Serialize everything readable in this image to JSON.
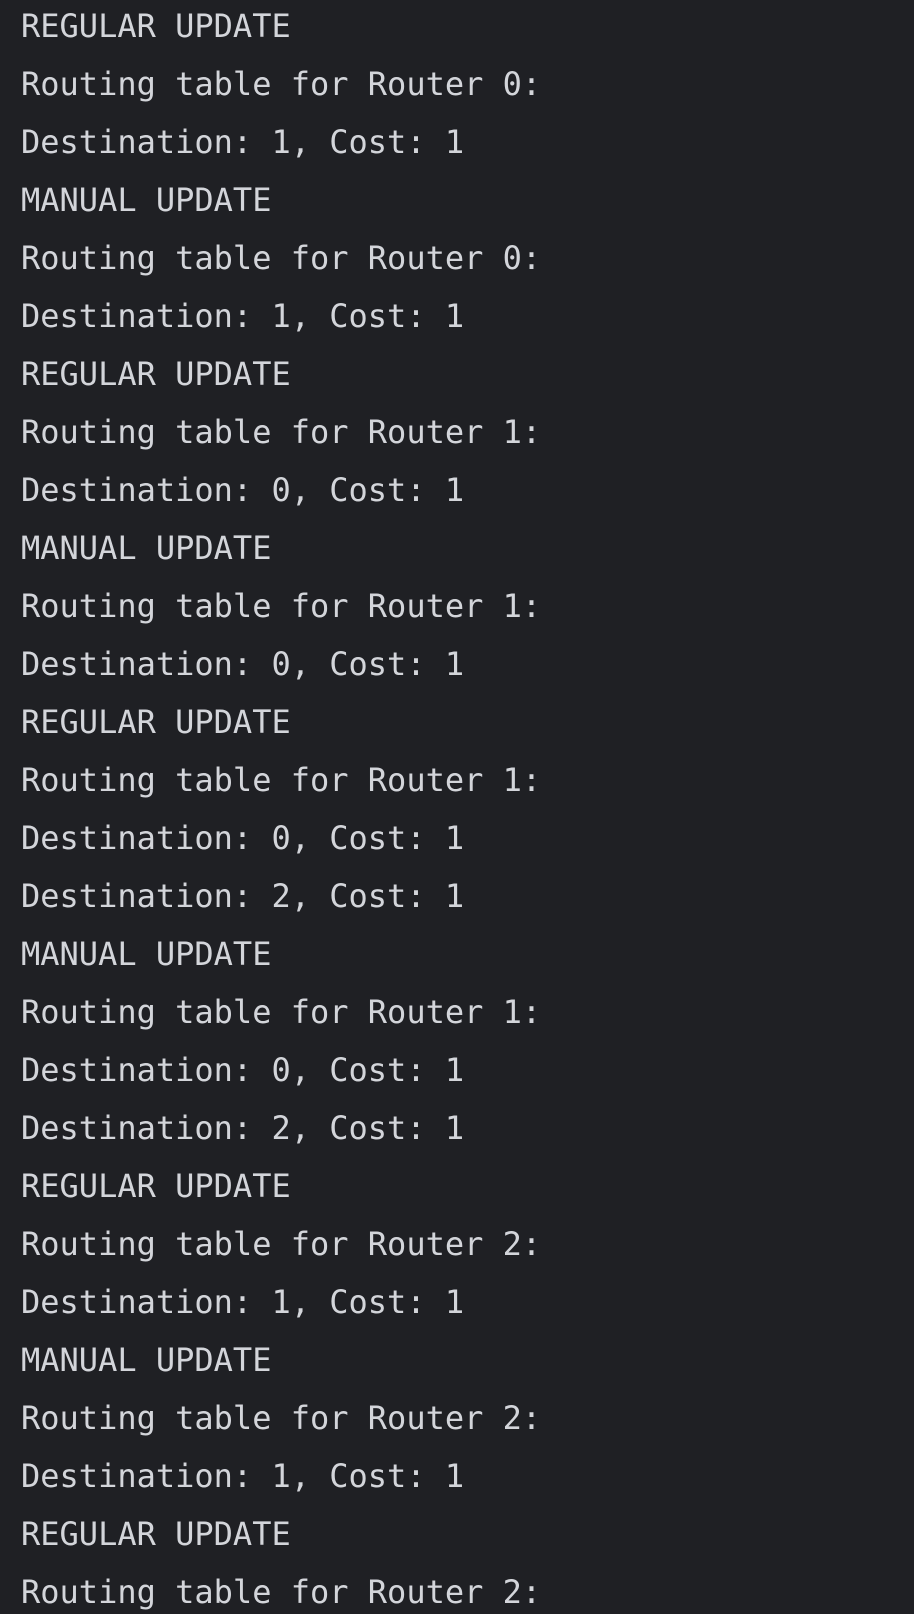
{
  "console": {
    "lines": [
      "REGULAR UPDATE",
      "Routing table for Router 0:",
      "Destination: 1, Cost: 1",
      "MANUAL UPDATE",
      "Routing table for Router 0:",
      "Destination: 1, Cost: 1",
      "REGULAR UPDATE",
      "Routing table for Router 1:",
      "Destination: 0, Cost: 1",
      "MANUAL UPDATE",
      "Routing table for Router 1:",
      "Destination: 0, Cost: 1",
      "REGULAR UPDATE",
      "Routing table for Router 1:",
      "Destination: 0, Cost: 1",
      "Destination: 2, Cost: 1",
      "MANUAL UPDATE",
      "Routing table for Router 1:",
      "Destination: 0, Cost: 1",
      "Destination: 2, Cost: 1",
      "REGULAR UPDATE",
      "Routing table for Router 2:",
      "Destination: 1, Cost: 1",
      "MANUAL UPDATE",
      "Routing table for Router 2:",
      "Destination: 1, Cost: 1",
      "REGULAR UPDATE",
      "Routing table for Router 2:"
    ]
  },
  "colors": {
    "background": "#1f2024",
    "text": "#d3d5da"
  }
}
